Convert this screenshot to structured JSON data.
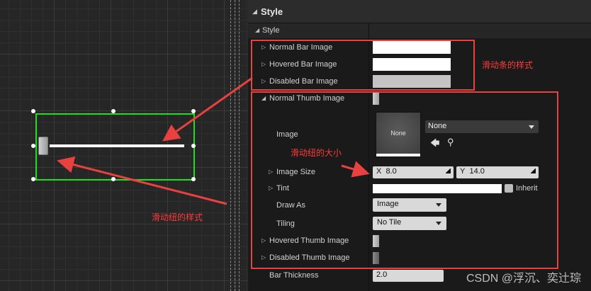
{
  "panel": {
    "title": "Style",
    "section": "Style"
  },
  "rows": {
    "normal_bar": "Normal Bar Image",
    "hovered_bar": "Hovered Bar Image",
    "disabled_bar": "Disabled Bar Image",
    "normal_thumb": "Normal Thumb Image",
    "image": "Image",
    "image_size": "Image Size",
    "tint": "Tint",
    "draw_as": "Draw As",
    "tiling": "Tiling",
    "hovered_thumb": "Hovered Thumb Image",
    "disabled_thumb": "Disabled Thumb Image",
    "bar_thickness": "Bar Thickness"
  },
  "values": {
    "preview_text": "None",
    "image_asset": "None",
    "size_x_label": "X",
    "size_x": "8.0",
    "size_y_label": "Y",
    "size_y": "14.0",
    "inherit": "Inherit",
    "draw_as": "Image",
    "tiling": "No Tile",
    "bar_thickness": "2.0"
  },
  "annotations": {
    "bar_style": "滑动条的样式",
    "thumb_size": "滑动纽的大小",
    "thumb_style": "滑动纽的样式"
  },
  "watermark": "CSDN @浮沉、奕辻琮",
  "icons": {
    "back": "arrow-left-icon",
    "browse": "search-icon"
  },
  "colors": {
    "selection": "#22dd22",
    "annotation": "#e8413f"
  }
}
